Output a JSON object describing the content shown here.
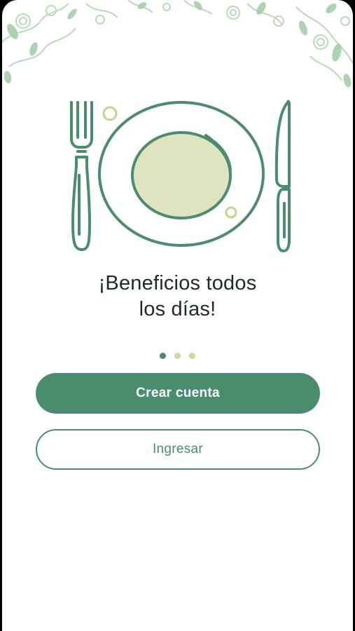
{
  "onboarding": {
    "title_line1": "¡Beneficios todos",
    "title_line2": "los días!",
    "illustration_icon": "plate-fork-knife-icon",
    "header_decoration": "floral-ornament",
    "pager": {
      "total": 3,
      "active_index": 0
    }
  },
  "actions": {
    "create_account_label": "Crear cuenta",
    "login_label": "Ingresar"
  },
  "colors": {
    "brand_green": "#4a8d6c",
    "plate_fill": "#dfe4c0",
    "dot_inactive": "#cfd89a",
    "ornament_green": "#a9d3ad",
    "text_dark": "#1f2a24"
  }
}
